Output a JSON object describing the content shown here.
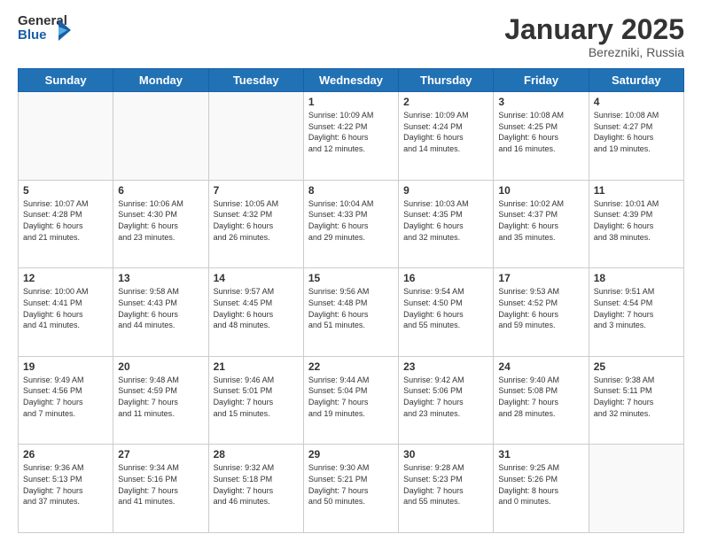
{
  "header": {
    "logo_general": "General",
    "logo_blue": "Blue",
    "title": "January 2025",
    "subtitle": "Berezniki, Russia"
  },
  "days_of_week": [
    "Sunday",
    "Monday",
    "Tuesday",
    "Wednesday",
    "Thursday",
    "Friday",
    "Saturday"
  ],
  "weeks": [
    [
      {
        "day": "",
        "info": ""
      },
      {
        "day": "",
        "info": ""
      },
      {
        "day": "",
        "info": ""
      },
      {
        "day": "1",
        "info": "Sunrise: 10:09 AM\nSunset: 4:22 PM\nDaylight: 6 hours\nand 12 minutes."
      },
      {
        "day": "2",
        "info": "Sunrise: 10:09 AM\nSunset: 4:24 PM\nDaylight: 6 hours\nand 14 minutes."
      },
      {
        "day": "3",
        "info": "Sunrise: 10:08 AM\nSunset: 4:25 PM\nDaylight: 6 hours\nand 16 minutes."
      },
      {
        "day": "4",
        "info": "Sunrise: 10:08 AM\nSunset: 4:27 PM\nDaylight: 6 hours\nand 19 minutes."
      }
    ],
    [
      {
        "day": "5",
        "info": "Sunrise: 10:07 AM\nSunset: 4:28 PM\nDaylight: 6 hours\nand 21 minutes."
      },
      {
        "day": "6",
        "info": "Sunrise: 10:06 AM\nSunset: 4:30 PM\nDaylight: 6 hours\nand 23 minutes."
      },
      {
        "day": "7",
        "info": "Sunrise: 10:05 AM\nSunset: 4:32 PM\nDaylight: 6 hours\nand 26 minutes."
      },
      {
        "day": "8",
        "info": "Sunrise: 10:04 AM\nSunset: 4:33 PM\nDaylight: 6 hours\nand 29 minutes."
      },
      {
        "day": "9",
        "info": "Sunrise: 10:03 AM\nSunset: 4:35 PM\nDaylight: 6 hours\nand 32 minutes."
      },
      {
        "day": "10",
        "info": "Sunrise: 10:02 AM\nSunset: 4:37 PM\nDaylight: 6 hours\nand 35 minutes."
      },
      {
        "day": "11",
        "info": "Sunrise: 10:01 AM\nSunset: 4:39 PM\nDaylight: 6 hours\nand 38 minutes."
      }
    ],
    [
      {
        "day": "12",
        "info": "Sunrise: 10:00 AM\nSunset: 4:41 PM\nDaylight: 6 hours\nand 41 minutes."
      },
      {
        "day": "13",
        "info": "Sunrise: 9:58 AM\nSunset: 4:43 PM\nDaylight: 6 hours\nand 44 minutes."
      },
      {
        "day": "14",
        "info": "Sunrise: 9:57 AM\nSunset: 4:45 PM\nDaylight: 6 hours\nand 48 minutes."
      },
      {
        "day": "15",
        "info": "Sunrise: 9:56 AM\nSunset: 4:48 PM\nDaylight: 6 hours\nand 51 minutes."
      },
      {
        "day": "16",
        "info": "Sunrise: 9:54 AM\nSunset: 4:50 PM\nDaylight: 6 hours\nand 55 minutes."
      },
      {
        "day": "17",
        "info": "Sunrise: 9:53 AM\nSunset: 4:52 PM\nDaylight: 6 hours\nand 59 minutes."
      },
      {
        "day": "18",
        "info": "Sunrise: 9:51 AM\nSunset: 4:54 PM\nDaylight: 7 hours\nand 3 minutes."
      }
    ],
    [
      {
        "day": "19",
        "info": "Sunrise: 9:49 AM\nSunset: 4:56 PM\nDaylight: 7 hours\nand 7 minutes."
      },
      {
        "day": "20",
        "info": "Sunrise: 9:48 AM\nSunset: 4:59 PM\nDaylight: 7 hours\nand 11 minutes."
      },
      {
        "day": "21",
        "info": "Sunrise: 9:46 AM\nSunset: 5:01 PM\nDaylight: 7 hours\nand 15 minutes."
      },
      {
        "day": "22",
        "info": "Sunrise: 9:44 AM\nSunset: 5:04 PM\nDaylight: 7 hours\nand 19 minutes."
      },
      {
        "day": "23",
        "info": "Sunrise: 9:42 AM\nSunset: 5:06 PM\nDaylight: 7 hours\nand 23 minutes."
      },
      {
        "day": "24",
        "info": "Sunrise: 9:40 AM\nSunset: 5:08 PM\nDaylight: 7 hours\nand 28 minutes."
      },
      {
        "day": "25",
        "info": "Sunrise: 9:38 AM\nSunset: 5:11 PM\nDaylight: 7 hours\nand 32 minutes."
      }
    ],
    [
      {
        "day": "26",
        "info": "Sunrise: 9:36 AM\nSunset: 5:13 PM\nDaylight: 7 hours\nand 37 minutes."
      },
      {
        "day": "27",
        "info": "Sunrise: 9:34 AM\nSunset: 5:16 PM\nDaylight: 7 hours\nand 41 minutes."
      },
      {
        "day": "28",
        "info": "Sunrise: 9:32 AM\nSunset: 5:18 PM\nDaylight: 7 hours\nand 46 minutes."
      },
      {
        "day": "29",
        "info": "Sunrise: 9:30 AM\nSunset: 5:21 PM\nDaylight: 7 hours\nand 50 minutes."
      },
      {
        "day": "30",
        "info": "Sunrise: 9:28 AM\nSunset: 5:23 PM\nDaylight: 7 hours\nand 55 minutes."
      },
      {
        "day": "31",
        "info": "Sunrise: 9:25 AM\nSunset: 5:26 PM\nDaylight: 8 hours\nand 0 minutes."
      },
      {
        "day": "",
        "info": ""
      }
    ]
  ]
}
